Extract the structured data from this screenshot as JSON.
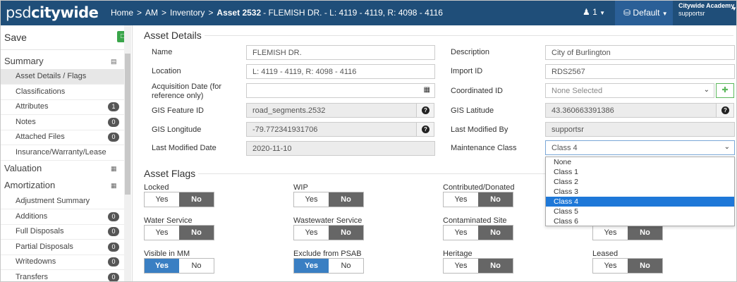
{
  "nav": {
    "logo_light": "psd",
    "logo_bold": "citywide",
    "crumbs": [
      "Home",
      "AM",
      "Inventory"
    ],
    "current": "Asset 2532",
    "current_detail": "- FLEMISH DR. - L: 4119 - 4119, R: 4098 - 4116",
    "notif_count": "1",
    "workspace": "Default",
    "org": "Citywide Academy",
    "user": "supportsr"
  },
  "sidebar": {
    "save_label": "Save",
    "summary_label": "Summary",
    "summary_items": [
      {
        "label": "Asset Details / Flags",
        "badge": ""
      },
      {
        "label": "Classifications",
        "badge": ""
      },
      {
        "label": "Attributes",
        "badge": "1"
      },
      {
        "label": "Notes",
        "badge": "0"
      },
      {
        "label": "Attached Files",
        "badge": "0"
      },
      {
        "label": "Insurance/Warranty/Lease",
        "badge": ""
      }
    ],
    "valuation_label": "Valuation",
    "amortization_label": "Amortization",
    "amortization_items": [
      {
        "label": "Adjustment Summary",
        "badge": ""
      },
      {
        "label": "Additions",
        "badge": "0"
      },
      {
        "label": "Full Disposals",
        "badge": "0"
      },
      {
        "label": "Partial Disposals",
        "badge": "0"
      },
      {
        "label": "Writedowns",
        "badge": "0"
      },
      {
        "label": "Transfers",
        "badge": "0"
      }
    ]
  },
  "details": {
    "title": "Asset Details",
    "name_label": "Name",
    "name_value": "FLEMISH DR.",
    "location_label": "Location",
    "location_value": "L: 4119 - 4119, R: 4098 - 4116",
    "acq_label_1": "Acquisition Date (for",
    "acq_label_2": "reference only)",
    "acq_value": "",
    "gis_feature_label": "GIS Feature ID",
    "gis_feature_value": "road_segments.2532",
    "gis_long_label": "GIS Longitude",
    "gis_long_value": "-79.772341931706",
    "last_mod_date_label": "Last Modified Date",
    "last_mod_date_value": "2020-11-10",
    "description_label": "Description",
    "description_value": "City of Burlington",
    "import_label": "Import ID",
    "import_value": "RDS2567",
    "coord_label": "Coordinated ID",
    "coord_placeholder": "None Selected",
    "gis_lat_label": "GIS Latitude",
    "gis_lat_value": "43.360663391386",
    "last_mod_by_label": "Last Modified By",
    "last_mod_by_value": "supportsr",
    "maint_label": "Maintenance Class",
    "maint_value": "Class 4"
  },
  "maintenance_options": [
    "None",
    "Class 1",
    "Class 2",
    "Class 3",
    "Class 4",
    "Class 5",
    "Class 6"
  ],
  "flags": {
    "title": "Asset Flags",
    "yes_label": "Yes",
    "no_label": "No",
    "items": [
      {
        "label": "Locked",
        "value": "No"
      },
      {
        "label": "WIP",
        "value": "No"
      },
      {
        "label": "Contributed/Donated",
        "value": "No"
      },
      {
        "label": "Water Service",
        "value": "No"
      },
      {
        "label": "Wastewater Service",
        "value": "No"
      },
      {
        "label": "Contaminated Site",
        "value": "No"
      },
      {
        "label": "",
        "value": "No"
      },
      {
        "label": "Visible in MM",
        "value": "Yes"
      },
      {
        "label": "Exclude from PSAB",
        "value": "Yes"
      },
      {
        "label": "Heritage",
        "value": "No"
      },
      {
        "label": "Leased",
        "value": "No"
      }
    ]
  },
  "colors": {
    "nav": "#1f4e79",
    "selected_yes": "#3a7fc3",
    "selected_no": "#666666",
    "dropdown_highlight": "#1e78d8",
    "save_icon": "#3aa54a"
  }
}
